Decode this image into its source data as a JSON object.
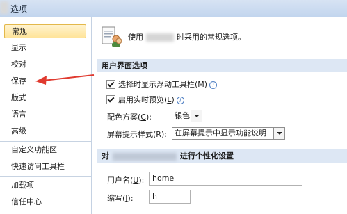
{
  "window": {
    "title": "选项"
  },
  "nav": {
    "items": [
      {
        "label": "常规",
        "selected": true
      },
      {
        "label": "显示"
      },
      {
        "label": "校对"
      },
      {
        "label": "保存"
      },
      {
        "label": "版式"
      },
      {
        "label": "语言"
      },
      {
        "label": "高级"
      },
      {
        "label": "自定义功能区"
      },
      {
        "label": "快速访问工具栏"
      },
      {
        "label": "加载项"
      },
      {
        "label": "信任中心"
      }
    ]
  },
  "general": {
    "intro_prefix": "使用",
    "intro_suffix": "时采用的常规选项。"
  },
  "ui_options": {
    "header": "用户界面选项",
    "mini_toolbar": {
      "label": "选择时显示浮动工具栏",
      "key": "M",
      "checked": true
    },
    "live_preview": {
      "label": "启用实时预览",
      "key": "L",
      "checked": true
    },
    "color_scheme": {
      "label": "配色方案",
      "key": "C",
      "value": "银色"
    },
    "screentip": {
      "label": "屏幕提示样式",
      "key": "R",
      "value": "在屏幕提示中显示功能说明"
    }
  },
  "personalize": {
    "header_prefix": "对",
    "header_suffix": "进行个性化设置",
    "username": {
      "label": "用户名",
      "key": "U",
      "value": "home"
    },
    "initials": {
      "label": "缩写",
      "key": "I",
      "value": "h"
    }
  },
  "colors": {
    "arrow": "#e03a2f",
    "selected_bg": "#ffe49a",
    "section_bg": "#dde7f4"
  }
}
